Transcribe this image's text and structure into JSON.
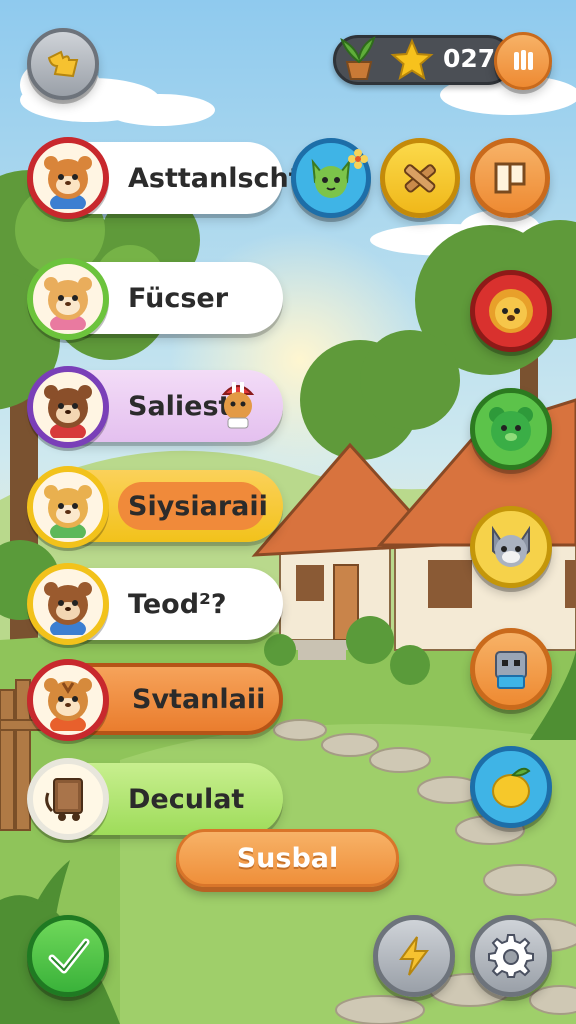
{
  "header": {
    "score": "027"
  },
  "menu": {
    "items": [
      {
        "label": "Asttanlscht"
      },
      {
        "label": "Fücser"
      },
      {
        "label": "Saliest"
      },
      {
        "label": "Siysiaraii"
      },
      {
        "label": "Teod²?"
      },
      {
        "label": "Svtanlaii"
      },
      {
        "label": "Deculat"
      }
    ]
  },
  "action": {
    "label": "Susbal"
  },
  "colors": {
    "sky": "#a9d8f0",
    "grass": "#9fcf6a",
    "accent_orange": "#ef8f3a",
    "red_ring": "#c8282d",
    "green_ring": "#6cc33c",
    "purple_ring": "#7a3fb8",
    "yellow_ring": "#f2c21b"
  }
}
